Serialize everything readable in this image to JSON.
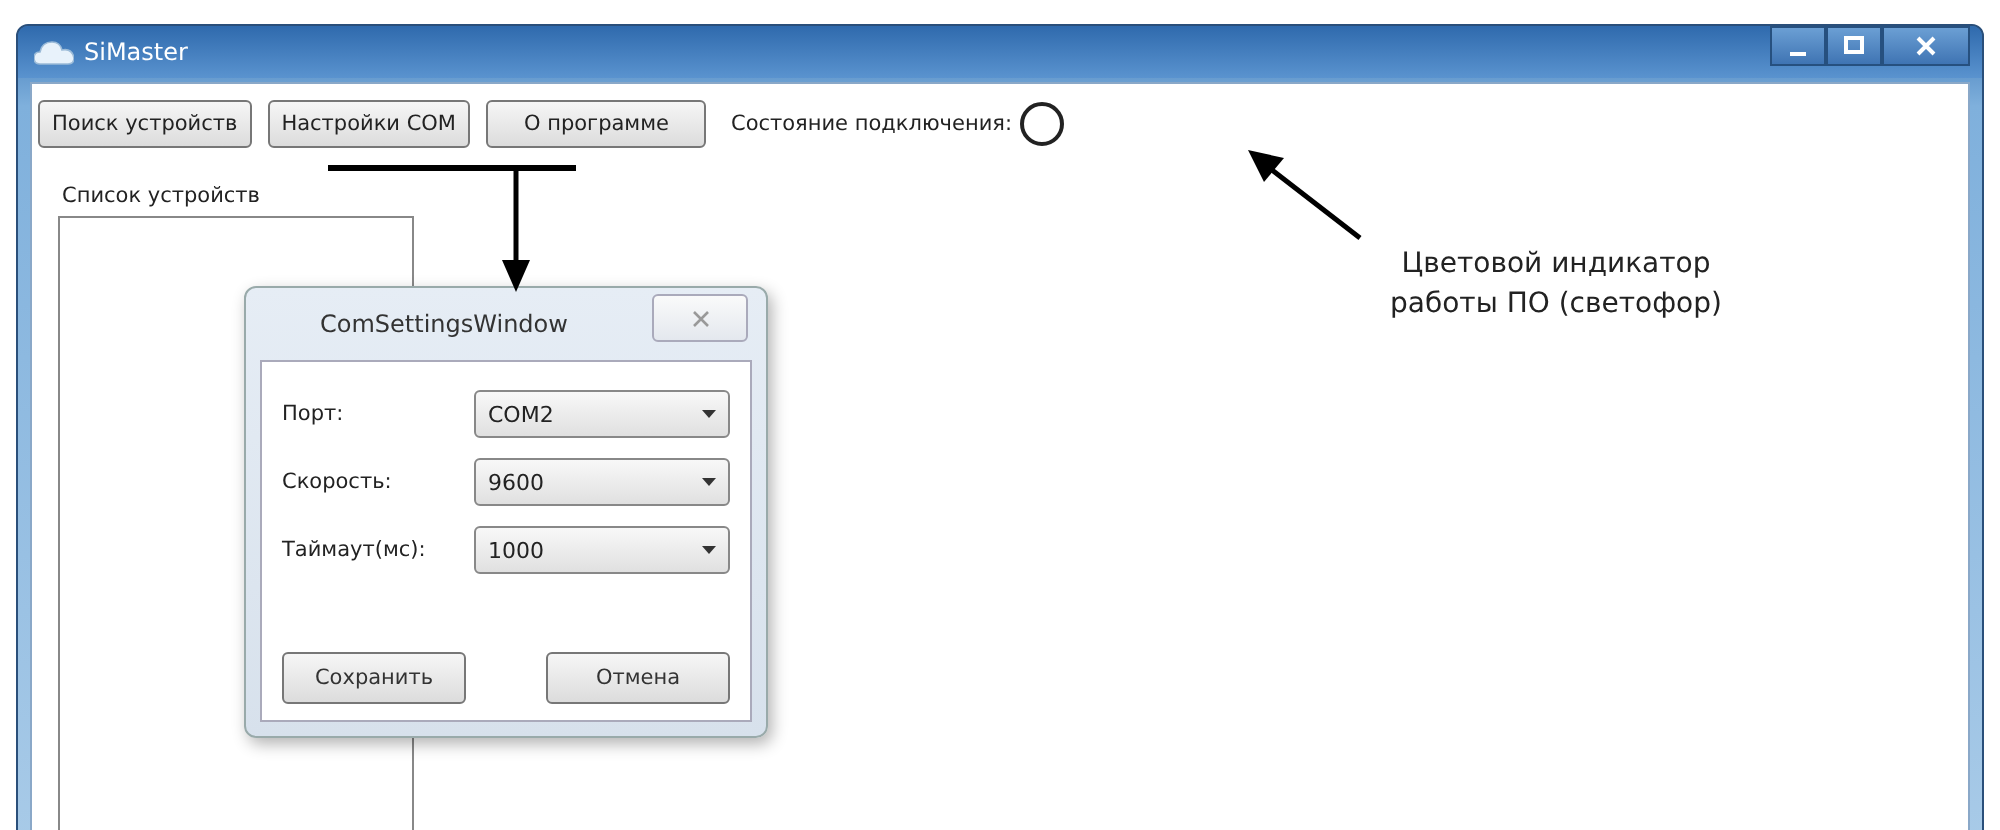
{
  "window": {
    "title": "SiMaster"
  },
  "toolbar": {
    "buttons": [
      "Поиск устройств",
      "Настройки COM",
      "О программе"
    ],
    "status_label": "Состояние подключения:"
  },
  "device_list": {
    "label": "Список устройств"
  },
  "dialog": {
    "title": "ComSettingsWindow",
    "fields": [
      {
        "label": "Порт:",
        "value": "COM2"
      },
      {
        "label": "Скорость:",
        "value": "9600"
      },
      {
        "label": "Таймаут(мс):",
        "value": "1000"
      }
    ],
    "buttons": [
      "Сохранить",
      "Отмена"
    ]
  },
  "annotation": {
    "text": "Цветовой индикатор работы ПО (светофор)"
  }
}
